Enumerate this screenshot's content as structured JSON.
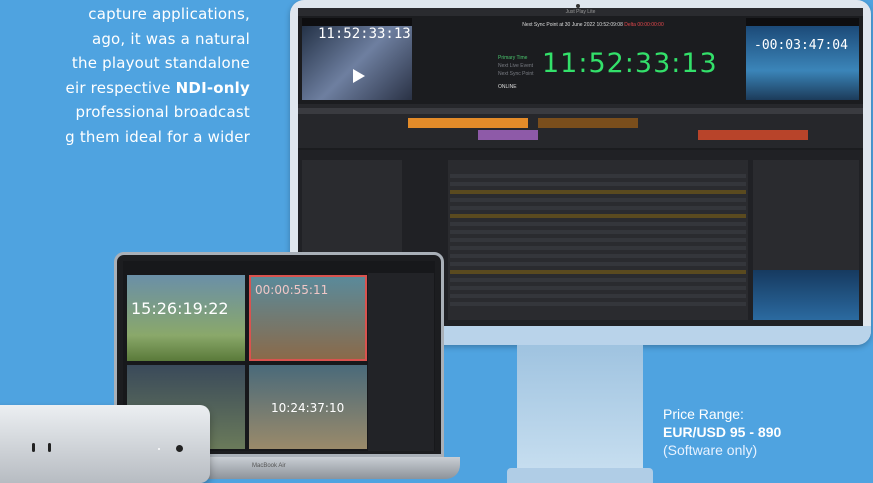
{
  "text_lines": {
    "l1": "capture applications,",
    "l2": "ago, it was a natural",
    "l3": "the playout standalone",
    "l4_pre": "eir respective ",
    "l4_bold": "NDI-only",
    "l5": "professional broadcast",
    "l6": "g them ideal for a wider"
  },
  "price": {
    "label": "Price Range:",
    "value": "EUR/USD 95 - 890",
    "note": "(Software only)"
  },
  "imac": {
    "window_title": "Just Play Lite",
    "info_line": "Next Sync Point at 30 June 2022 10:52:09:08",
    "info_red": "Delta 00:00:00:00",
    "left_timecode": "11:52:33:13",
    "big_timecode": "11:52:33:13",
    "right_timecode": "-00:03:47:04",
    "status_labels": [
      "Primary Time",
      "Next Live Event",
      "Next Sync Point"
    ],
    "online": "ONLINE"
  },
  "laptop": {
    "tc1": "15:26:19:22",
    "tc2": "00:00:55:11",
    "tc3": "10:24:37:10",
    "base_label": "MacBook Air"
  },
  "colors": {
    "background": "#4fa3e0",
    "timecode_green": "#33e06a",
    "accent_orange": "#e38b29"
  }
}
